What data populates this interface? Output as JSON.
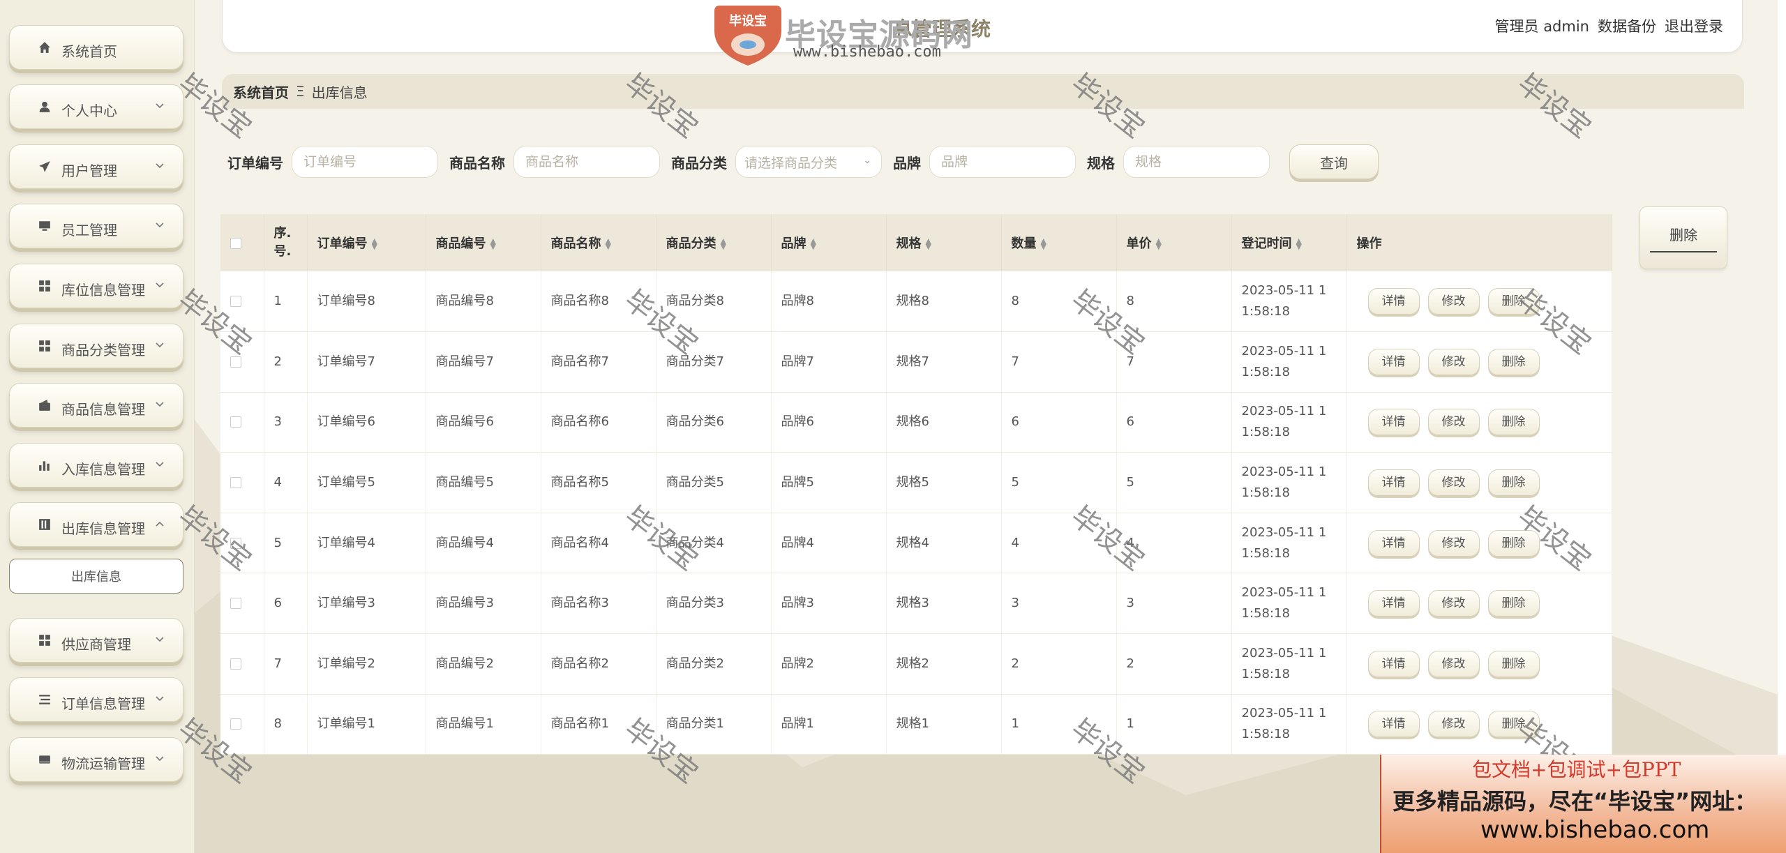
{
  "header": {
    "system_title": "息管理系统",
    "links": [
      "管理员 admin",
      "数据备份",
      "退出登录"
    ],
    "logo": {
      "brand": "毕设宝源码网",
      "badge": "毕设宝",
      "url": "www.bishebao.com"
    }
  },
  "sidebar": {
    "items": [
      {
        "label": "系统首页",
        "icon": "home-icon",
        "expand": false
      },
      {
        "label": "个人中心",
        "icon": "user-icon",
        "expand": true
      },
      {
        "label": "用户管理",
        "icon": "send-icon",
        "expand": true
      },
      {
        "label": "员工管理",
        "icon": "monitor-icon",
        "expand": true
      },
      {
        "label": "库位信息管理",
        "icon": "grid-icon",
        "expand": true
      },
      {
        "label": "商品分类管理",
        "icon": "grid-icon",
        "expand": true
      },
      {
        "label": "商品信息管理",
        "icon": "wallet-icon",
        "expand": true
      },
      {
        "label": "入库信息管理",
        "icon": "bar-chart-icon",
        "expand": true
      },
      {
        "label": "出库信息管理",
        "icon": "folder-icon",
        "expand": true,
        "open": true
      },
      {
        "label": "供应商管理",
        "icon": "grid-icon",
        "expand": true
      },
      {
        "label": "订单信息管理",
        "icon": "list-icon",
        "expand": true
      },
      {
        "label": "物流运输管理",
        "icon": "box-icon",
        "expand": true
      }
    ],
    "sub_item": "出库信息"
  },
  "breadcrumb": {
    "home": "系统首页",
    "sep": "Ξ",
    "current": "出库信息"
  },
  "search": {
    "fields": [
      {
        "label": "订单编号",
        "placeholder": "订单编号",
        "type": "input"
      },
      {
        "label": "商品名称",
        "placeholder": "商品名称",
        "type": "input"
      },
      {
        "label": "商品分类",
        "placeholder": "请选择商品分类",
        "type": "select"
      },
      {
        "label": "品牌",
        "placeholder": "品牌",
        "type": "input"
      },
      {
        "label": "规格",
        "placeholder": "规格",
        "type": "input"
      }
    ],
    "query_label": "查询"
  },
  "delete_label": "删除",
  "table": {
    "columns": [
      "序号",
      "订单编号",
      "商品编号",
      "商品名称",
      "商品分类",
      "品牌",
      "规格",
      "数量",
      "单价",
      "登记时间",
      "操作"
    ],
    "index_header": [
      "序.",
      "号."
    ],
    "rows": [
      {
        "no": "1",
        "order": "订单编号8",
        "goods": "商品编号8",
        "name": "商品名称8",
        "cat": "商品分类8",
        "brand": "品牌8",
        "spec": "规格8",
        "qty": "8",
        "price": "8",
        "time1": "2023-05-11 1",
        "time2": "1:58:18"
      },
      {
        "no": "2",
        "order": "订单编号7",
        "goods": "商品编号7",
        "name": "商品名称7",
        "cat": "商品分类7",
        "brand": "品牌7",
        "spec": "规格7",
        "qty": "7",
        "price": "7",
        "time1": "2023-05-11 1",
        "time2": "1:58:18"
      },
      {
        "no": "3",
        "order": "订单编号6",
        "goods": "商品编号6",
        "name": "商品名称6",
        "cat": "商品分类6",
        "brand": "品牌6",
        "spec": "规格6",
        "qty": "6",
        "price": "6",
        "time1": "2023-05-11 1",
        "time2": "1:58:18"
      },
      {
        "no": "4",
        "order": "订单编号5",
        "goods": "商品编号5",
        "name": "商品名称5",
        "cat": "商品分类5",
        "brand": "品牌5",
        "spec": "规格5",
        "qty": "5",
        "price": "5",
        "time1": "2023-05-11 1",
        "time2": "1:58:18"
      },
      {
        "no": "5",
        "order": "订单编号4",
        "goods": "商品编号4",
        "name": "商品名称4",
        "cat": "商品分类4",
        "brand": "品牌4",
        "spec": "规格4",
        "qty": "4",
        "price": "4",
        "time1": "2023-05-11 1",
        "time2": "1:58:18"
      },
      {
        "no": "6",
        "order": "订单编号3",
        "goods": "商品编号3",
        "name": "商品名称3",
        "cat": "商品分类3",
        "brand": "品牌3",
        "spec": "规格3",
        "qty": "3",
        "price": "3",
        "time1": "2023-05-11 1",
        "time2": "1:58:18"
      },
      {
        "no": "7",
        "order": "订单编号2",
        "goods": "商品编号2",
        "name": "商品名称2",
        "cat": "商品分类2",
        "brand": "品牌2",
        "spec": "规格2",
        "qty": "2",
        "price": "2",
        "time1": "2023-05-11 1",
        "time2": "1:58:18"
      },
      {
        "no": "8",
        "order": "订单编号1",
        "goods": "商品编号1",
        "name": "商品名称1",
        "cat": "商品分类1",
        "brand": "品牌1",
        "spec": "规格1",
        "qty": "1",
        "price": "1",
        "time1": "2023-05-11 1",
        "time2": "1:58:18"
      }
    ],
    "row_actions": [
      "详情",
      "修改",
      "删除"
    ]
  },
  "watermark": "毕设宝",
  "ad": {
    "line1": "包文档+包调试+包PPT",
    "line2": "更多精品源码，尽在“毕设宝”网址：",
    "line3": "www.bishebao.com"
  },
  "colors": {
    "accent": "#ede8d9",
    "sidebar_bg": "#f1eddf",
    "ad_red": "#d23b2c"
  }
}
